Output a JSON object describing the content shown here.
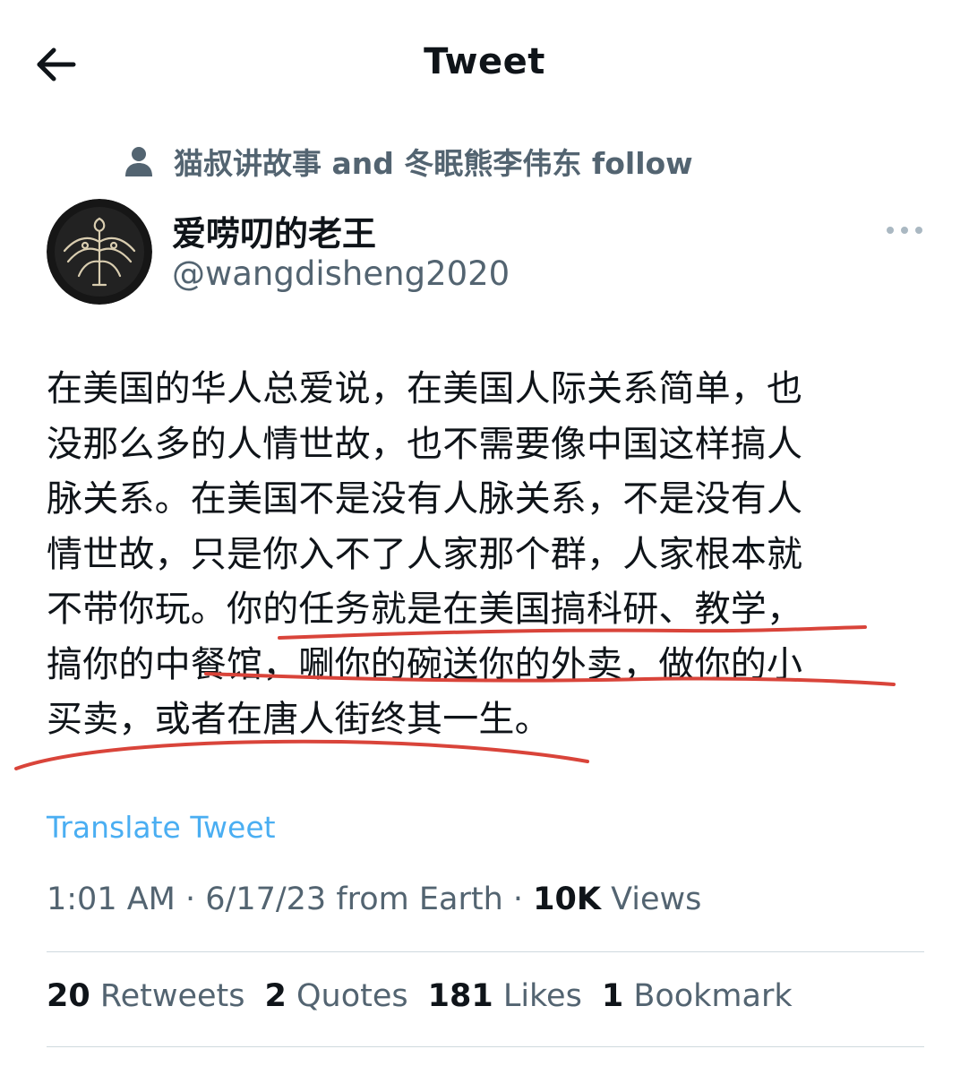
{
  "header": {
    "title": "Tweet",
    "back_icon": "arrow-left-icon"
  },
  "social_context": {
    "icon": "person-icon",
    "text": "猫叔讲故事 and 冬眠熊李伟东 follow"
  },
  "author": {
    "display_name": "爱唠叨的老王",
    "handle": "@wangdisheng2020",
    "avatar_icon": "phoenix-emblem-avatar"
  },
  "more_icon": "more-horizontal-icon",
  "tweet": {
    "lines": [
      "在美国的华人总爱说，在美国人际关系简单，也",
      "没那么多的人情世故，也不需要像中国这样搞人",
      "脉关系。在美国不是没有人脉关系，不是没有人",
      "情世故，只是你入不了人家那个群，人家根本就",
      "不带你玩。你的任务就是在美国搞科研、教学，",
      "搞你的中餐馆，唰你的碗送你的外卖，做你的小",
      "买卖，或者在唐人街终其一生。"
    ],
    "annotation_color": "#d9443a"
  },
  "translate_label": "Translate Tweet",
  "meta": {
    "time": "1:01 AM",
    "sep1": " · ",
    "date": "6/17/23",
    "from": " from Earth",
    "sep2": " · ",
    "views_count": "10K",
    "views_label": " Views"
  },
  "stats": [
    {
      "count": "20",
      "label": " Retweets"
    },
    {
      "count": "2",
      "label": " Quotes"
    },
    {
      "count": "181",
      "label": " Likes"
    },
    {
      "count": "1",
      "label": " Bookmark"
    }
  ],
  "colors": {
    "text": "#0f1419",
    "secondary": "#536471",
    "link": "#1d9bf0",
    "divider": "#cfd9de"
  }
}
